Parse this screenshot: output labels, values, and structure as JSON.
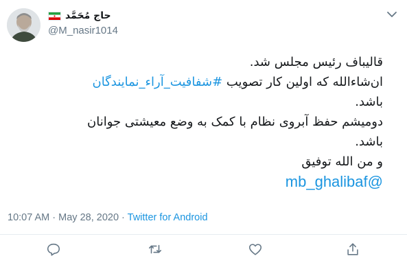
{
  "user": {
    "display_name": "حاج مُحَمَّد",
    "handle": "@M_nasir1014",
    "flag_icon": "iran-flag-icon"
  },
  "tweet": {
    "line1": "قالیباف رئیس مجلس شد.",
    "line2_text": "ان‌شاءالله که اولین کار تصویب ",
    "hashtag": "#شفافیت_آراء_نمایندگان",
    "line3": "باشد.",
    "line4": "دومیشم حفظ آبروی نظام با کمک به وضع معیشتی جوانان",
    "line5": "باشد.",
    "line6": "و من الله توفیق",
    "mention": "@mb_ghalibaf"
  },
  "meta": {
    "time": "10:07 AM",
    "separator1": " · ",
    "date": "May 28, 2020",
    "separator2": " · ",
    "source": "Twitter for Android"
  },
  "actions": {
    "reply_icon": "reply-icon",
    "retweet_icon": "retweet-icon",
    "like_icon": "like-icon",
    "share_icon": "share-icon"
  },
  "colors": {
    "link": "#1b95e0",
    "muted": "#657786",
    "text": "#14171a",
    "divider": "#e6ecf0"
  }
}
